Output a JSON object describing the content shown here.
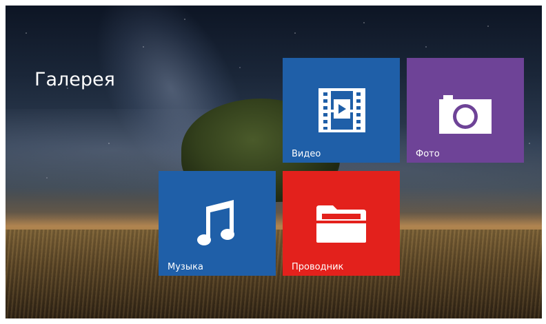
{
  "page": {
    "title": "Галерея"
  },
  "tiles": [
    {
      "id": "video",
      "label": "Видео",
      "icon": "film-play-icon",
      "color": "#1f5fa8"
    },
    {
      "id": "photo",
      "label": "Фото",
      "icon": "camera-icon",
      "color": "#6e4397"
    },
    {
      "id": "music",
      "label": "Музыка",
      "icon": "music-note-icon",
      "color": "#1f5fa8"
    },
    {
      "id": "explorer",
      "label": "Проводник",
      "icon": "folder-open-icon",
      "color": "#e3211c"
    }
  ]
}
